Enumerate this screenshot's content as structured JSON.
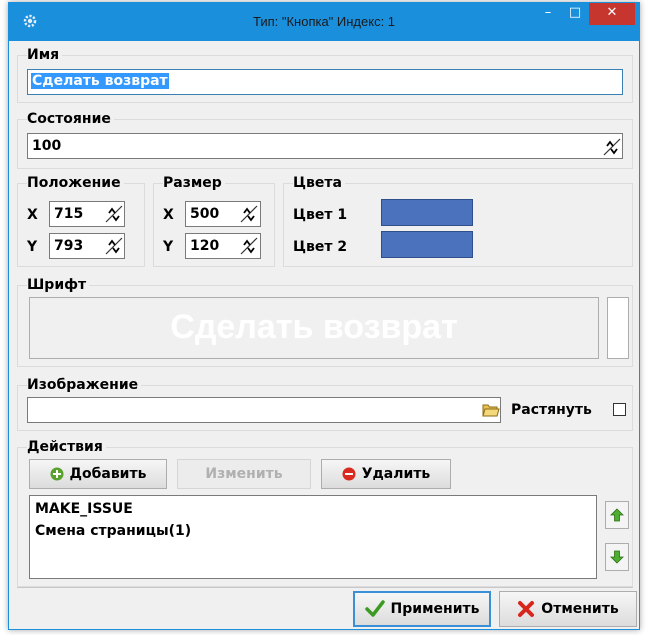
{
  "window": {
    "title": "Тип: \"Кнопка\" Индекс: 1",
    "minimize": "–",
    "maximize": "□",
    "close": "✕"
  },
  "name_group": {
    "label": "Имя",
    "value": "Сделать возврат"
  },
  "state_group": {
    "label": "Состояние",
    "value": "100"
  },
  "position_group": {
    "label": "Положение",
    "x_label": "X",
    "x_value": "715",
    "y_label": "Y",
    "y_value": "793"
  },
  "size_group": {
    "label": "Размер",
    "x_label": "X",
    "x_value": "500",
    "y_label": "Y",
    "y_value": "120"
  },
  "colors_group": {
    "label": "Цвета",
    "color1_label": "Цвет 1",
    "color1": "#4a72bd",
    "color2_label": "Цвет 2",
    "color2": "#4a72bd"
  },
  "font_group": {
    "label": "Шрифт",
    "preview_text": "Сделать возврат"
  },
  "image_group": {
    "label": "Изображение",
    "value": "",
    "stretch_label": "Растянуть",
    "stretch_checked": false
  },
  "actions_group": {
    "label": "Действия",
    "add_label": "Добавить",
    "edit_label": "Изменить",
    "delete_label": "Удалить",
    "items": [
      "MAKE_ISSUE",
      "Смена страницы(1)"
    ]
  },
  "footer": {
    "apply_label": "Применить",
    "cancel_label": "Отменить"
  }
}
